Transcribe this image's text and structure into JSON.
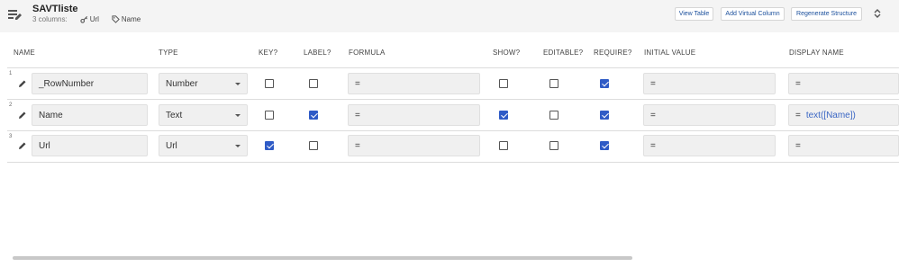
{
  "header": {
    "title": "SAVTliste",
    "columns_count": "3 columns:",
    "key_label": "Url",
    "label_label": "Name",
    "view_table": "View Table",
    "add_virtual_column": "Add Virtual Column",
    "regenerate_structure": "Regenerate Structure"
  },
  "columns": {
    "name": "NAME",
    "type": "TYPE",
    "key": "KEY?",
    "label": "LABEL?",
    "formula": "FORMULA",
    "show": "SHOW?",
    "editable": "EDITABLE?",
    "require": "REQUIRE?",
    "initial_value": "INITIAL VALUE",
    "display_name": "DISPLAY NAME"
  },
  "rows": [
    {
      "num": "1",
      "name": "_RowNumber",
      "type": "Number",
      "key": false,
      "label": false,
      "formula": "=",
      "show": false,
      "editable": false,
      "require": true,
      "initial": "=",
      "display_eq": "=",
      "display_value": ""
    },
    {
      "num": "2",
      "name": "Name",
      "type": "Text",
      "key": false,
      "label": true,
      "formula": "=",
      "show": true,
      "editable": false,
      "require": true,
      "initial": "=",
      "display_eq": "=",
      "display_value": "text([Name])"
    },
    {
      "num": "3",
      "name": "Url",
      "type": "Url",
      "key": true,
      "label": false,
      "formula": "=",
      "show": false,
      "editable": false,
      "require": true,
      "initial": "=",
      "display_eq": "=",
      "display_value": ""
    }
  ]
}
